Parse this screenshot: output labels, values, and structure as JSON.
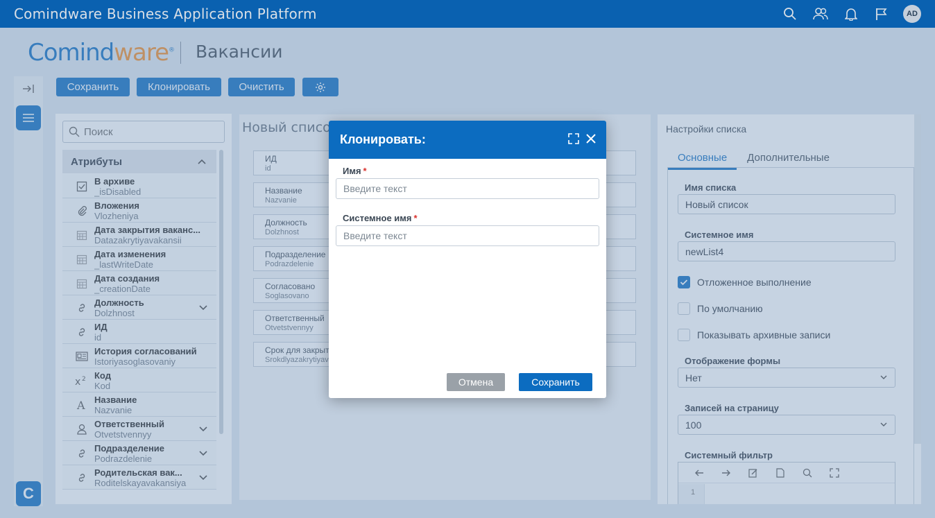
{
  "app": {
    "title": "Comindware Business Application Platform",
    "user_initials": "AD"
  },
  "header": {
    "logo_part1": "Comind",
    "logo_part2": "ware",
    "logo_reg": "®",
    "page_title": "Вакансии"
  },
  "toolbar": {
    "save": "Сохранить",
    "clone": "Клонировать",
    "clear": "Очистить"
  },
  "rail": {
    "logo_letter": "C"
  },
  "attributes": {
    "search_placeholder": "Поиск",
    "heading": "Атрибуты",
    "items": [
      {
        "name": "В архиве",
        "sys": "_isDisabled",
        "icon": "checkbox-icon"
      },
      {
        "name": "Вложения",
        "sys": "Vlozheniya",
        "icon": "paperclip-icon"
      },
      {
        "name": "Дата закрытия ваканс...",
        "sys": "Datazakrytiyavakansii",
        "icon": "calendar-icon"
      },
      {
        "name": "Дата изменения",
        "sys": "_lastWriteDate",
        "icon": "calendar-icon"
      },
      {
        "name": "Дата создания",
        "sys": "_creationDate",
        "icon": "calendar-icon"
      },
      {
        "name": "Должность",
        "sys": "Dolzhnost",
        "icon": "link-icon",
        "expand": true
      },
      {
        "name": "ИД",
        "sys": "id",
        "icon": "link-icon"
      },
      {
        "name": "История согласований",
        "sys": "Istoriyasoglasovaniy",
        "icon": "document-icon"
      },
      {
        "name": "Код",
        "sys": "Kod",
        "icon": "superscript-icon"
      },
      {
        "name": "Название",
        "sys": "Nazvanie",
        "icon": "text-icon"
      },
      {
        "name": "Ответственный",
        "sys": "Otvetstvennyy",
        "icon": "user-icon",
        "expand": true
      },
      {
        "name": "Подразделение",
        "sys": "Podrazdelenie",
        "icon": "link-icon",
        "expand": true
      },
      {
        "name": "Родительская вак...",
        "sys": "Roditelskayavakansiya",
        "icon": "link-icon",
        "expand": true
      }
    ]
  },
  "form": {
    "title": "Новый список",
    "fields": [
      {
        "label": "ИД",
        "sys": "id"
      },
      {
        "label": "Название",
        "sys": "Nazvanie"
      },
      {
        "label": "Должность",
        "sys": "Dolzhnost"
      },
      {
        "label": "Подразделение",
        "sys": "Podrazdelenie"
      },
      {
        "label": "Согласовано",
        "sys": "Soglasovano"
      },
      {
        "label": "Ответственный",
        "sys": "Otvetstvennyy"
      },
      {
        "label": "Срок для закрытия",
        "sys": "Srokdlyazakrytiyavakansii"
      }
    ]
  },
  "settings": {
    "title": "Настройки списка",
    "tabs": [
      "Основные",
      "Дополнительные"
    ],
    "list_name_label": "Имя списка",
    "list_name_value": "Новый список",
    "system_name_label": "Системное имя",
    "system_name_value": "newList4",
    "deferred_label": "Отложенное выполнение",
    "default_label": "По умолчанию",
    "show_archived_label": "Показывать архивные записи",
    "form_display_label": "Отображение формы",
    "form_display_value": "Нет",
    "per_page_label": "Записей на страницу",
    "per_page_value": "100",
    "system_filter_label": "Системный фильтр",
    "editor_line": "1"
  },
  "modal": {
    "title": "Клонировать:",
    "name_label": "Имя",
    "name_placeholder": "Введите текст",
    "sysname_label": "Системное имя",
    "sysname_placeholder": "Введите текст",
    "required_mark": "*",
    "cancel": "Отмена",
    "save": "Сохранить"
  },
  "colors": {
    "brand": "#0c6cc0",
    "accent": "#f28c28",
    "required": "#d9302c"
  }
}
